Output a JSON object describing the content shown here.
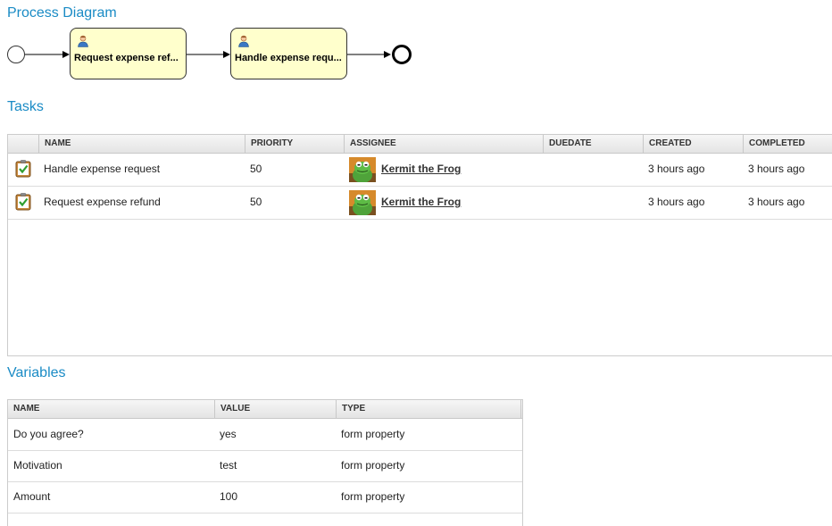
{
  "sections": {
    "diagram_title": "Process Diagram",
    "tasks_title": "Tasks",
    "variables_title": "Variables"
  },
  "diagram": {
    "nodes": [
      {
        "label": "Request expense ref..."
      },
      {
        "label": "Handle expense requ..."
      }
    ]
  },
  "tasks": {
    "columns": [
      "NAME",
      "PRIORITY",
      "ASSIGNEE",
      "DUEDATE",
      "CREATED",
      "COMPLETED"
    ],
    "rows": [
      {
        "name": "Handle expense request",
        "priority": "50",
        "assignee": "Kermit the Frog",
        "duedate": "",
        "created": "3 hours ago",
        "completed": "3 hours ago"
      },
      {
        "name": "Request expense refund",
        "priority": "50",
        "assignee": "Kermit the Frog",
        "duedate": "",
        "created": "3 hours ago",
        "completed": "3 hours ago"
      }
    ]
  },
  "variables": {
    "columns": [
      "NAME",
      "VALUE",
      "TYPE"
    ],
    "rows": [
      {
        "name": "Do you agree?",
        "value": "yes",
        "type": "form property"
      },
      {
        "name": "Motivation",
        "value": "test",
        "type": "form property"
      },
      {
        "name": "Amount",
        "value": "100",
        "type": "form property"
      }
    ]
  },
  "colors": {
    "title": "#1a8bc5",
    "task_fill": "#ffffcc"
  }
}
